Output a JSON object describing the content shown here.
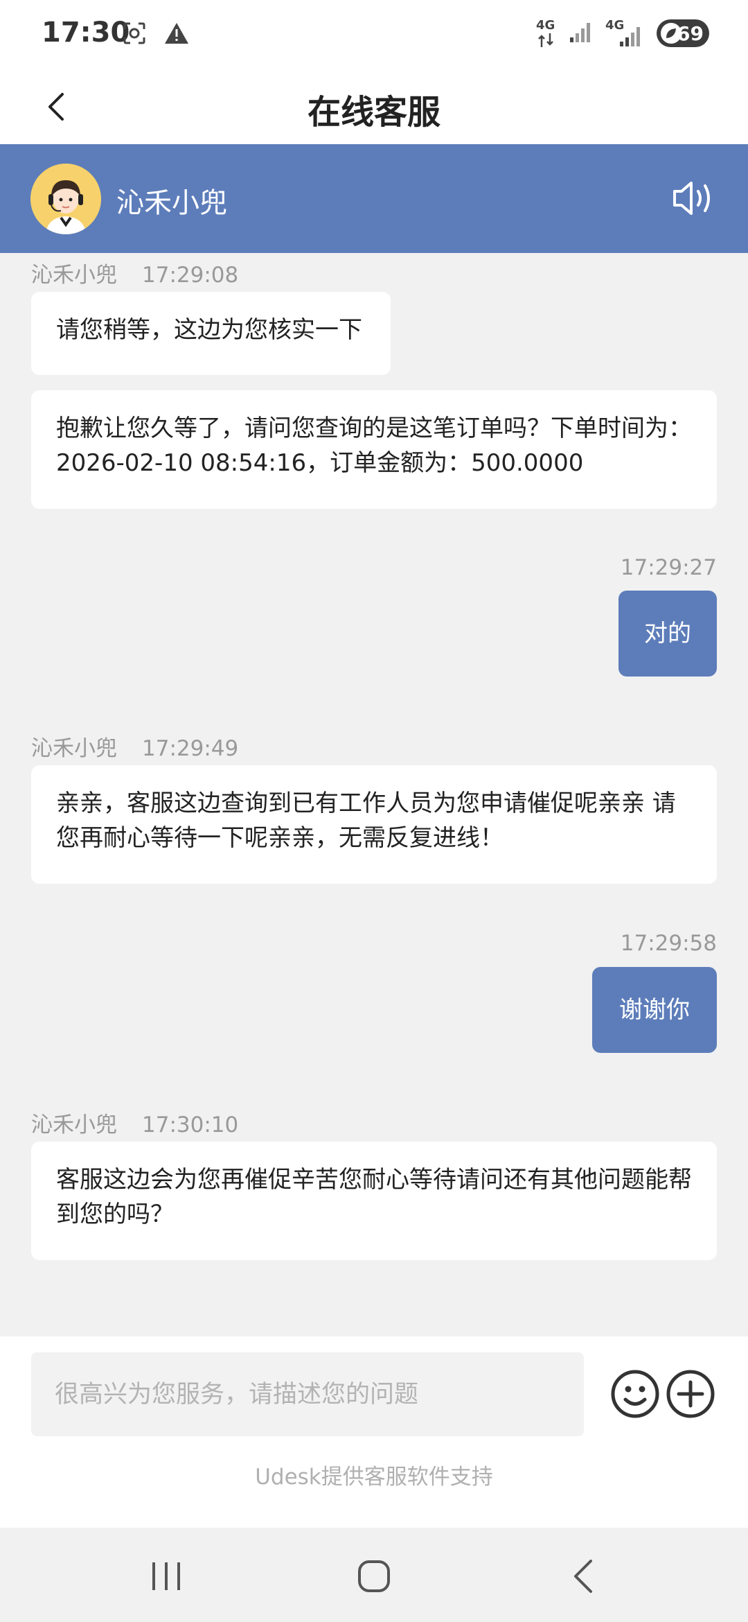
{
  "status_bar": {
    "time": "17:30",
    "network_1": "4G",
    "network_2": "4G",
    "battery": "69"
  },
  "header": {
    "title": "在线客服"
  },
  "agent": {
    "name": "沁禾小兜"
  },
  "messages": [
    {
      "type": "meta_in",
      "sender": "沁禾小兜",
      "time": "17:29:08"
    },
    {
      "type": "in",
      "text": "请您稍等，这边为您核实一下"
    },
    {
      "type": "in",
      "text": "抱歉让您久等了，请问您查询的是这笔订单吗？下单时间为：2026-02-10 08:54:16，订单金额为：500.0000"
    },
    {
      "type": "meta_out",
      "time": "17:29:27"
    },
    {
      "type": "out",
      "text": "对的"
    },
    {
      "type": "meta_in",
      "sender": "沁禾小兜",
      "time": "17:29:49"
    },
    {
      "type": "in",
      "text": "亲亲，客服这边查询到已有工作人员为您申请催促呢亲亲 请您再耐心等待一下呢亲亲，无需反复进线！"
    },
    {
      "type": "meta_out",
      "time": "17:29:58"
    },
    {
      "type": "out",
      "text": "谢谢你"
    },
    {
      "type": "meta_in",
      "sender": "沁禾小兜",
      "time": "17:30:10"
    },
    {
      "type": "in",
      "text": "客服这边会为您再催促辛苦您耐心等待请问还有其他问题能帮到您的吗？"
    }
  ],
  "input": {
    "placeholder": "很高兴为您服务，请描述您的问题"
  },
  "footer": {
    "powered_by": "Udesk提供客服软件支持"
  },
  "icons": {
    "back": "chevron-left-icon",
    "speaker": "speaker-icon",
    "emoji": "smiley-icon",
    "plus": "plus-circle-icon",
    "nav_recent": "recent-apps-icon",
    "nav_home": "home-icon",
    "nav_back": "back-icon"
  },
  "colors": {
    "accent": "#5d7dba",
    "background": "#f1f1f2",
    "bubble_in": "#ffffff",
    "meta_text": "#999999"
  }
}
